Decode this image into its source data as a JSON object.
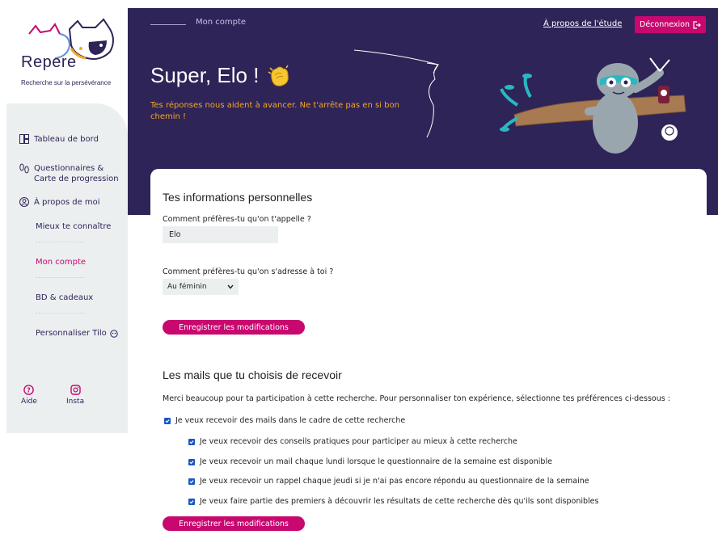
{
  "logo": {
    "name": "Repere",
    "tagline": "Recherche sur la persévérance"
  },
  "sidebar": {
    "items": [
      {
        "label": "Tableau de bord",
        "icon": "dashboard-icon"
      },
      {
        "label": "Questionnaires & Carte de progression",
        "icon": "footprints-icon"
      },
      {
        "label": "À propos de moi",
        "icon": "user-circle-icon"
      }
    ],
    "sub_items": [
      {
        "label": "Mieux te connaître",
        "active": false
      },
      {
        "label": "Mon compte",
        "active": true
      },
      {
        "label": "BD & cadeaux",
        "active": false
      },
      {
        "label": "Personnaliser Tilo",
        "active": false
      }
    ],
    "bottom": [
      {
        "label": "Aide",
        "icon": "help-icon"
      },
      {
        "label": "Insta",
        "icon": "instagram-icon"
      }
    ]
  },
  "header": {
    "breadcrumb": "Mon compte",
    "about_link": "À propos de l'étude",
    "logout_label": "Déconnexion",
    "greeting": "Super, Elo !",
    "subtitle": "Tes réponses nous aident à avancer. Ne t'arrête pas en si bon chemin !"
  },
  "personal": {
    "title": "Tes informations personnelles",
    "name_label": "Comment préfères-tu qu'on t'appelle ?",
    "name_value": "Elo",
    "address_label": "Comment préfères-tu qu'on s'adresse à toi ?",
    "address_value": "Au féminin",
    "save_label": "Enregistrer les modifications"
  },
  "mails": {
    "title": "Les mails que tu choisis de recevoir",
    "intro": "Merci beaucoup pour ta participation à cette recherche. Pour personnaliser ton expérience, sélectionne tes préférences ci-dessous :",
    "main_option": "Je veux recevoir des mails dans le cadre de cette recherche",
    "options": [
      "Je veux recevoir des conseils pratiques pour participer au mieux à cette recherche",
      "Je veux recevoir un mail chaque lundi lorsque le questionnaire de la semaine est disponible",
      "Je veux recevoir un rappel chaque jeudi si je n'ai pas encore répondu au questionnaire de la semaine",
      "Je veux faire partie des premiers à découvrir les résultats de cette recherche dès qu'ils sont disponibles"
    ],
    "save_label": "Enregistrer les modifications"
  },
  "colors": {
    "primary": "#2e2457",
    "accent": "#c8086f",
    "highlight": "#f5a623",
    "panel": "#eceff0",
    "checkbox": "#1a57c4"
  }
}
